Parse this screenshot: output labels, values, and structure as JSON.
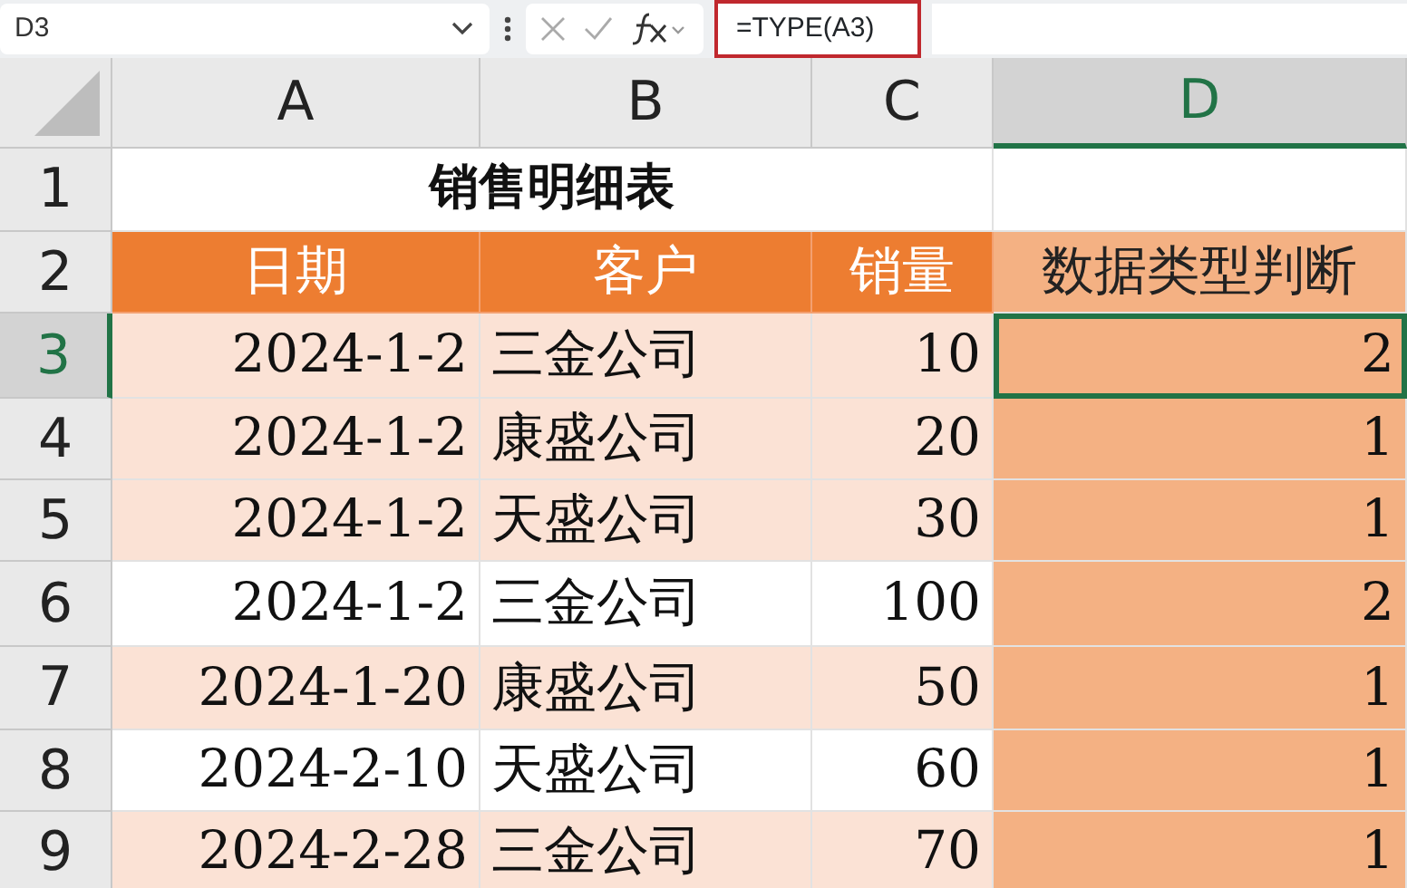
{
  "name_box": "D3",
  "formula": "=TYPE(A3)",
  "columns": [
    {
      "label": "A",
      "selected": false
    },
    {
      "label": "B",
      "selected": false
    },
    {
      "label": "C",
      "selected": false
    },
    {
      "label": "D",
      "selected": true
    }
  ],
  "title_row": {
    "number": "1",
    "title": "销售明细表"
  },
  "header_row": {
    "number": "2",
    "cells": [
      "日期",
      "客户",
      "销量",
      "数据类型判断"
    ]
  },
  "rows": [
    {
      "number": "3",
      "selected": true,
      "shaded": true,
      "cells": [
        "2024-1-2",
        "三金公司",
        "10",
        "2"
      ]
    },
    {
      "number": "4",
      "selected": false,
      "shaded": true,
      "cells": [
        "2024-1-2",
        "康盛公司",
        "20",
        "1"
      ]
    },
    {
      "number": "5",
      "selected": false,
      "shaded": true,
      "cells": [
        "2024-1-2",
        "天盛公司",
        "30",
        "1"
      ]
    },
    {
      "number": "6",
      "selected": false,
      "shaded": false,
      "cells": [
        "2024-1-2",
        "三金公司",
        "100",
        "2"
      ]
    },
    {
      "number": "7",
      "selected": false,
      "shaded": true,
      "cells": [
        "2024-1-20",
        "康盛公司",
        "50",
        "1"
      ]
    },
    {
      "number": "8",
      "selected": false,
      "shaded": false,
      "cells": [
        "2024-2-10",
        "天盛公司",
        "60",
        "1"
      ]
    },
    {
      "number": "9",
      "selected": false,
      "shaded": true,
      "cells": [
        "2024-2-28",
        "三金公司",
        "70",
        "1"
      ]
    }
  ]
}
